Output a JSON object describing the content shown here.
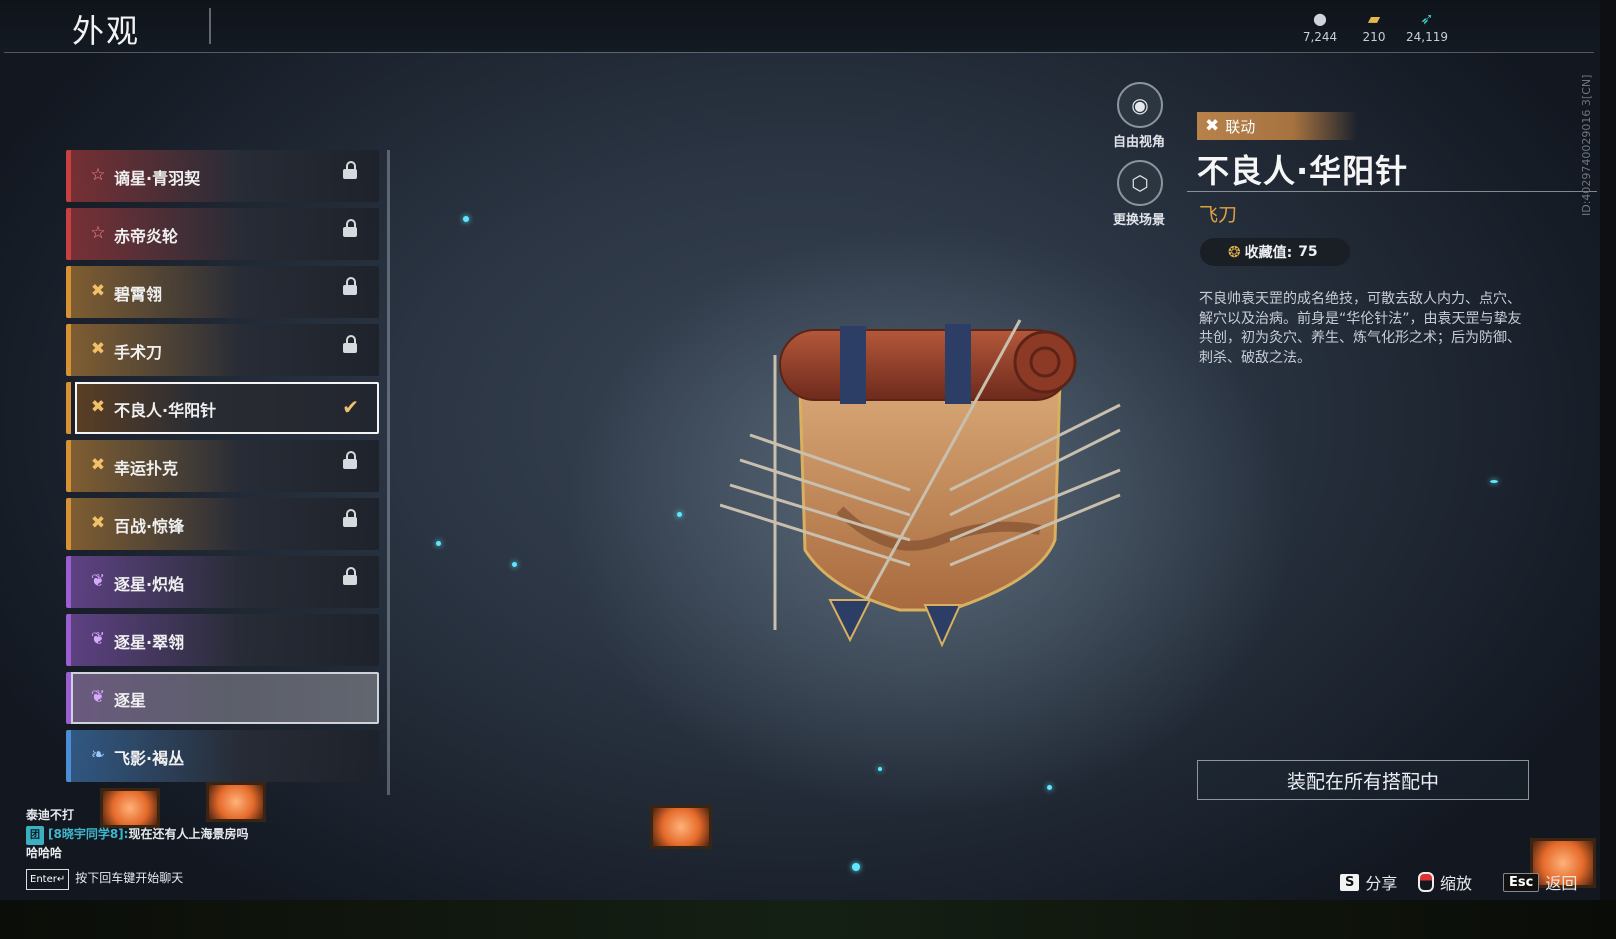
{
  "header": {
    "title": "外观"
  },
  "currencies": [
    {
      "icon": "coin-icon",
      "value": "7,244"
    },
    {
      "icon": "ticket-icon",
      "value": "210"
    },
    {
      "icon": "feather-icon",
      "value": "24,119"
    }
  ],
  "list": {
    "items": [
      {
        "label": "谪星·青羽契",
        "icon": "star-outline-icon",
        "tier_color": "#c94040",
        "locked": true,
        "state": "normal"
      },
      {
        "label": "赤帝炎轮",
        "icon": "star-outline-icon",
        "tier_color": "#c94040",
        "locked": true,
        "state": "normal"
      },
      {
        "label": "碧霄翎",
        "icon": "cross-blades-icon",
        "tier_color": "#d79236",
        "locked": true,
        "state": "normal"
      },
      {
        "label": "手术刀",
        "icon": "cross-blades-icon",
        "tier_color": "#d79236",
        "locked": true,
        "state": "normal"
      },
      {
        "label": "不良人·华阳针",
        "icon": "cross-blades-icon",
        "tier_color": "#d79236",
        "locked": false,
        "state": "selected"
      },
      {
        "label": "幸运扑克",
        "icon": "cross-blades-icon",
        "tier_color": "#d79236",
        "locked": true,
        "state": "normal"
      },
      {
        "label": "百战·惊锋",
        "icon": "cross-blades-icon",
        "tier_color": "#d79236",
        "locked": true,
        "state": "normal"
      },
      {
        "label": "逐星·炽焰",
        "icon": "wings-icon",
        "tier_color": "#9a5fd0",
        "locked": true,
        "state": "normal"
      },
      {
        "label": "逐星·翠翎",
        "icon": "wings-icon",
        "tier_color": "#9a5fd0",
        "locked": false,
        "state": "normal"
      },
      {
        "label": "逐星",
        "icon": "wings-icon",
        "tier_color": "#9a5fd0",
        "locked": false,
        "state": "hover"
      },
      {
        "label": "飞影·褐丛",
        "icon": "small-wings-icon",
        "tier_color": "#4a8fd6",
        "locked": false,
        "state": "normal"
      }
    ]
  },
  "view_controls": {
    "free_view": "自由视角",
    "change_scene": "更换场景"
  },
  "detail": {
    "tag": "联动",
    "name": "不良人·华阳针",
    "type": "飞刀",
    "collect_label": "收藏值:",
    "collect_value": "75",
    "description": "不良帅袁天罡的成名绝技，可散去敌人内力、点穴、解穴以及治病。前身是“华伦针法”，由袁天罡与挚友共创，初为灸穴、养生、炼气化形之术；后为防御、刺杀、破敌之法。",
    "equip_button": "装配在所有搭配中",
    "item_id": "ID:4029740029016 3[CN]"
  },
  "hints": {
    "share_key": "S",
    "share_label": "分享",
    "zoom_label": "缩放",
    "back_key": "Esc",
    "back_label": "返回"
  },
  "chat": {
    "line1": "泰迪不打",
    "channel": "团",
    "sender": "[8晓宇同学8]:",
    "message": "现在还有人上海景房吗",
    "line3": "哈哈哈",
    "enter_key": "Enter↵",
    "prompt": "按下回车键开始聊天"
  },
  "colors": {
    "accent_gold": "#e0a23e",
    "tag_bg": "#b8824a"
  }
}
